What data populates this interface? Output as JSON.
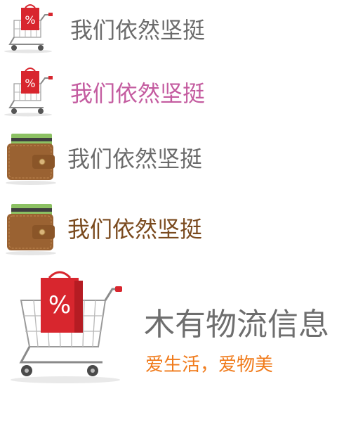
{
  "colors": {
    "label_gray": "#6b6b6b",
    "label_pink": "#c45ca0",
    "label_brown": "#7a4a1e",
    "title_gray": "#6e6e6e",
    "accent_orange": "#f07a1a",
    "bag_red": "#d8262e",
    "wallet_brown": "#9a6232",
    "card_green": "#8cc163"
  },
  "rows": [
    {
      "label": "我们依然坚挺",
      "icon": "shopping-cart-icon"
    },
    {
      "label": "我们依然坚挺",
      "icon": "shopping-cart-icon"
    },
    {
      "label": "我们依然坚挺",
      "icon": "wallet-icon"
    },
    {
      "label": "我们依然坚挺",
      "icon": "wallet-icon"
    }
  ],
  "cart_badge": "%",
  "empty_state": {
    "icon": "shopping-cart-icon",
    "title": "木有物流信息",
    "subtitle": "爱生活，爱物美"
  }
}
